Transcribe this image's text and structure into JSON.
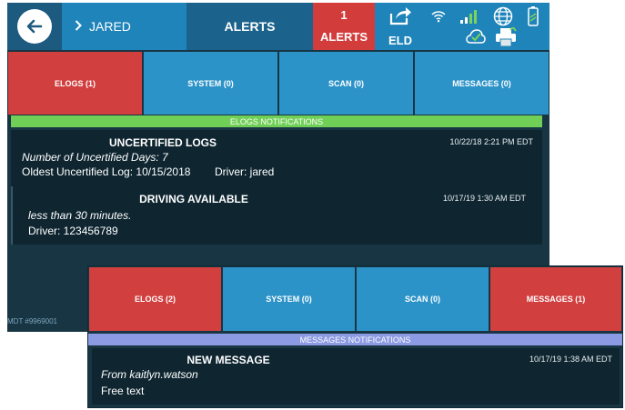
{
  "header": {
    "user_name": "JARED",
    "alerts_title": "ALERTS",
    "alert_count": "1",
    "alert_count_label": "ALERTS",
    "eld_label": "ELD"
  },
  "back_screen": {
    "tabs": [
      {
        "label": "ELOGS (1)",
        "state": "red"
      },
      {
        "label": "SYSTEM (0)",
        "state": "blue"
      },
      {
        "label": "SCAN (0)",
        "state": "blue"
      },
      {
        "label": "MESSAGES (0)",
        "state": "blue"
      }
    ],
    "band_label": "ELOGS NOTIFICATIONS",
    "cards": [
      {
        "title": "UNCERTIFIED LOGS",
        "time": "10/22/18 2:21 PM EDT",
        "line1": "Number of Uncertified Days: 7",
        "line2": "Oldest Uncertified Log: 10/15/2018",
        "driver": "Driver: jared"
      },
      {
        "title": "DRIVING AVAILABLE",
        "time": "10/17/19 1:30 AM EDT",
        "line1": "less than 30 minutes.",
        "line2": "Driver: 123456789"
      }
    ],
    "footer_mdt": "MDT #9969001"
  },
  "front_screen": {
    "tabs": [
      {
        "label": "ELOGS (2)",
        "state": "red"
      },
      {
        "label": "SYSTEM (0)",
        "state": "blue"
      },
      {
        "label": "SCAN (0)",
        "state": "blue"
      },
      {
        "label": "MESSAGES (1)",
        "state": "red"
      }
    ],
    "band_label": "MESSAGES NOTIFICATIONS",
    "card": {
      "title": "NEW MESSAGE",
      "time": "10/17/19 1:38 AM EDT",
      "line1": "From kaitlyn.watson",
      "line2": "Free text"
    }
  },
  "colors": {
    "header_dark": "#1c5a7f",
    "header_blue": "#1f84b9",
    "alert_red": "#d23d3c",
    "tab_blue": "#2c93c8",
    "band_green": "#70cf56",
    "band_lavender": "#8b9ae2",
    "panel_bg": "#173543"
  },
  "icons": [
    "back-arrow-icon",
    "chevron-right-icon",
    "export-icon",
    "wifi-icon",
    "signal-icon",
    "globe-icon",
    "phone-battery-icon",
    "cloud-check-icon",
    "printer-icon"
  ]
}
